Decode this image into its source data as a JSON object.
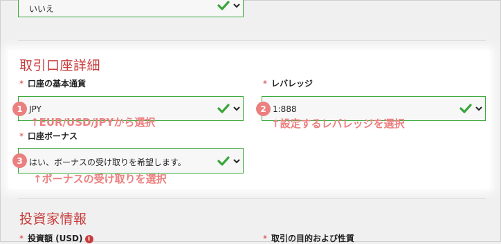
{
  "top_select": {
    "value": "いいえ"
  },
  "account": {
    "section_title": "取引口座詳細",
    "required_mark": "*",
    "base_currency": {
      "label": "口座の基本通貨",
      "value": "JPY"
    },
    "leverage": {
      "label": "レバレッジ",
      "value": "1:888"
    },
    "bonus": {
      "label": "口座ボーナス",
      "value": "はい、ボーナスの受け取りを希望します。"
    }
  },
  "annotations": {
    "badges": [
      "1",
      "2",
      "3"
    ],
    "note_currency": "↑EUR/USD/JPYから選択",
    "note_leverage": "↑設定するレバレッジを選択",
    "note_bonus": "↑ボーナスの受け取りを選択"
  },
  "investor": {
    "section_title": "投資家情報",
    "investment_amount_label": "投資額 (USD)",
    "info_icon_text": "i",
    "purpose_label": "取引の目的および性質"
  },
  "colors": {
    "accent_red": "#c73c3c",
    "check_green": "#3aa53a",
    "annotation_pink": "#ec7f7f"
  },
  "icons": [
    "check-icon",
    "chevron-down-icon",
    "info-icon"
  ]
}
